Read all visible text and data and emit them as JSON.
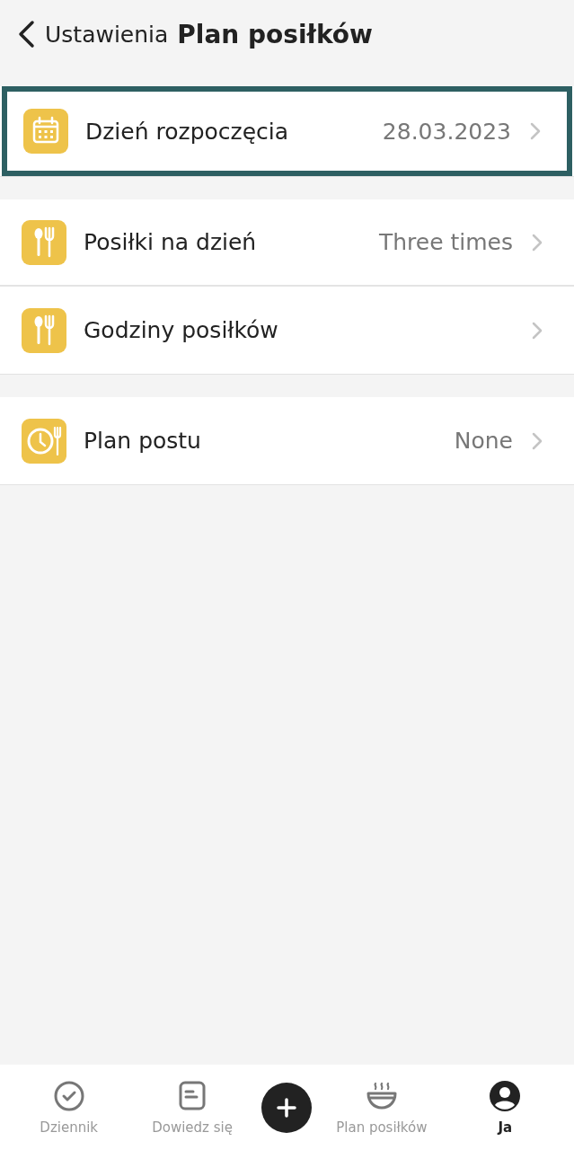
{
  "header": {
    "back_label": "Ustawienia",
    "title": "Plan posiłków"
  },
  "groups": [
    {
      "rows": [
        {
          "kind": "calendar",
          "label": "Dzień rozpoczęcia",
          "value": "28.03.2023",
          "highlighted": true
        }
      ]
    },
    {
      "rows": [
        {
          "kind": "cutlery",
          "label": "Posiłki na dzień",
          "value": "Three times",
          "highlighted": false
        },
        {
          "kind": "cutlery",
          "label": "Godziny posiłków",
          "highlighted": false
        }
      ]
    },
    {
      "rows": [
        {
          "kind": "clock-cutlery",
          "label": "Plan postu",
          "value": "None",
          "highlighted": false
        }
      ]
    }
  ],
  "tab_bar": [
    {
      "kind": "check",
      "label": "Dziennik",
      "selected": false
    },
    {
      "kind": "note",
      "label": "Dowiedz się",
      "selected": false
    },
    {
      "kind": "add"
    },
    {
      "kind": "bowl",
      "label": "Plan posiłków",
      "selected": false
    },
    {
      "kind": "person",
      "label": "Ja",
      "selected": true
    }
  ]
}
